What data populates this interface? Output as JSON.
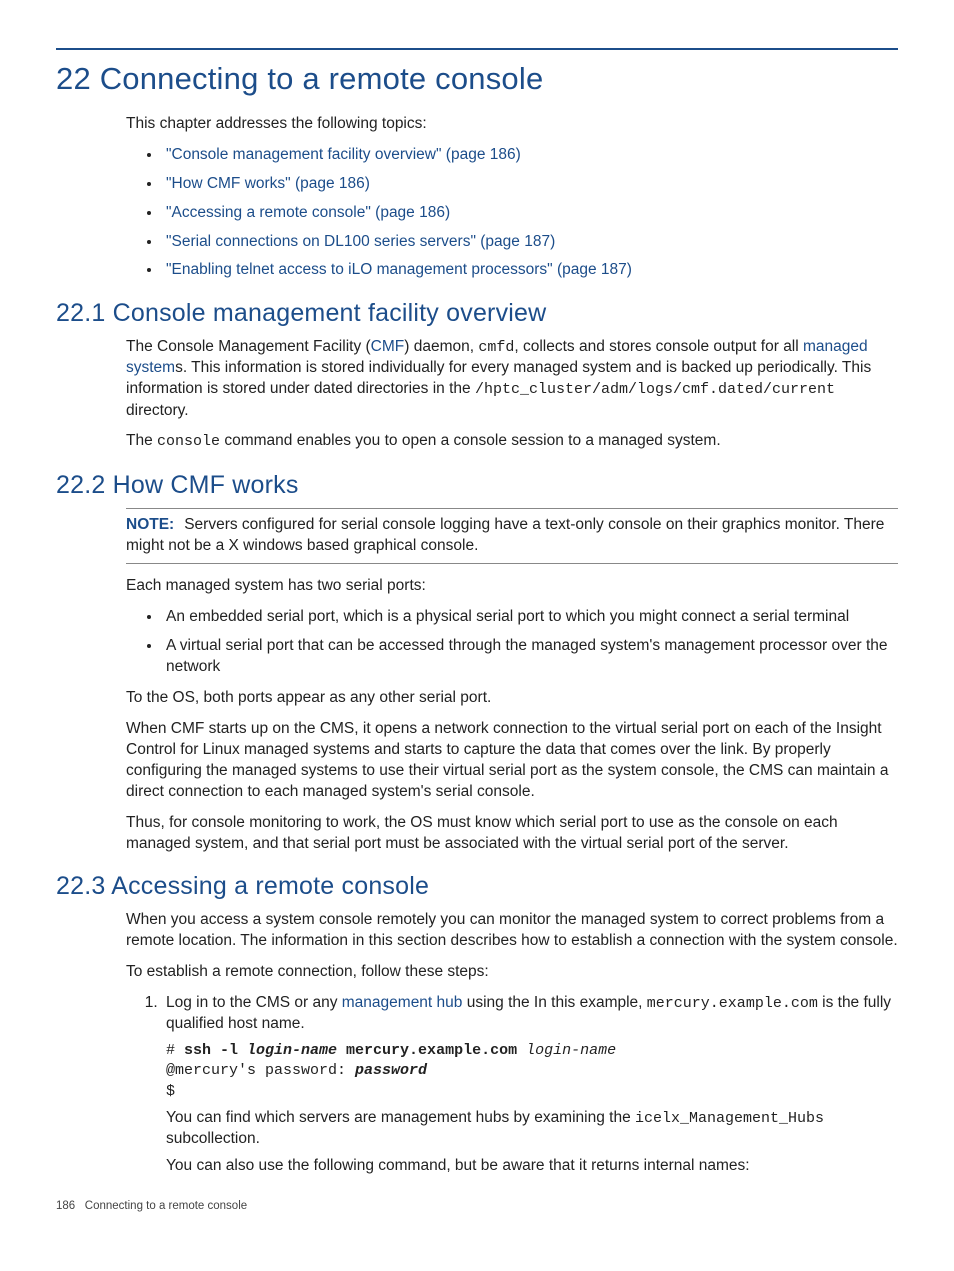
{
  "chapter": {
    "title": "22 Connecting to a remote console",
    "intro": "This chapter addresses the following topics:",
    "toc": [
      "\"Console management facility overview\" (page 186)",
      "\"How CMF works\" (page 186)",
      "\"Accessing a remote console\" (page 186)",
      "\"Serial connections on DL100 series servers\" (page 187)",
      "\"Enabling telnet access to iLO management processors\" (page 187)"
    ]
  },
  "s221": {
    "heading": "22.1 Console management facility overview",
    "p1_a": "The Console Management Facility (",
    "p1_link1": "CMF",
    "p1_b": ") daemon, ",
    "p1_code1": "cmfd",
    "p1_c": ", collects and stores console output for all ",
    "p1_link2": "managed system",
    "p1_d": "s. This information is stored individually for every managed system and is backed up periodically. This information is stored under dated directories in the ",
    "p1_code2": "/hptc_cluster/adm/logs/cmf.dated/current",
    "p1_e": " directory.",
    "p2_a": "The ",
    "p2_code1": "console",
    "p2_b": " command enables you to open a console session to a managed system."
  },
  "s222": {
    "heading": "22.2 How CMF works",
    "note_label": "NOTE:",
    "note_text": "Servers configured for serial console logging have a text-only console on their graphics monitor. There might not be a X windows based graphical console.",
    "p1": "Each managed system has two serial ports:",
    "bullets": [
      "An embedded serial port, which is a physical serial port to which you might connect a serial terminal",
      "A virtual serial port that can be accessed through the managed system's management processor over the network"
    ],
    "p2": "To the OS, both ports appear as any other serial port.",
    "p3": "When CMF starts up on the CMS, it opens a network connection to the virtual serial port on each of the Insight Control for Linux managed systems and starts to capture the data that comes over the link. By properly configuring the managed systems to use their virtual serial port as the system console, the CMS can maintain a direct connection to each managed system's serial console.",
    "p4": "Thus, for console monitoring to work, the OS must know which serial port to use as the console on each managed system, and that serial port must be associated with the virtual serial port of the server."
  },
  "s223": {
    "heading": "22.3 Accessing a remote console",
    "p1": "When you access a system console remotely you can monitor the managed system to correct problems from a remote location. The information in this section describes how to establish a connection with the system console.",
    "p2": "To establish a remote connection, follow these steps:",
    "step1_a": "Log in to the CMS or any ",
    "step1_link": "management hub",
    "step1_b": " using the In this example, ",
    "step1_code": "mercury.example.com",
    "step1_c": " is the fully qualified host name.",
    "code_hash": "# ",
    "code_ssh": "ssh -l ",
    "code_login1": "login-name",
    "code_host": " mercury.example.com ",
    "code_login2": "login-name",
    "code_line2": "@mercury's password: ",
    "code_pw": "password",
    "code_line3": "$",
    "step1_p2_a": "You can find which servers are management hubs by examining the ",
    "step1_p2_code": "icelx_Management_Hubs",
    "step1_p2_b": " subcollection.",
    "step1_p3": "You can also use the following command, but be aware that it returns internal names:"
  },
  "footer": {
    "page": "186",
    "title": "Connecting to a remote console"
  }
}
